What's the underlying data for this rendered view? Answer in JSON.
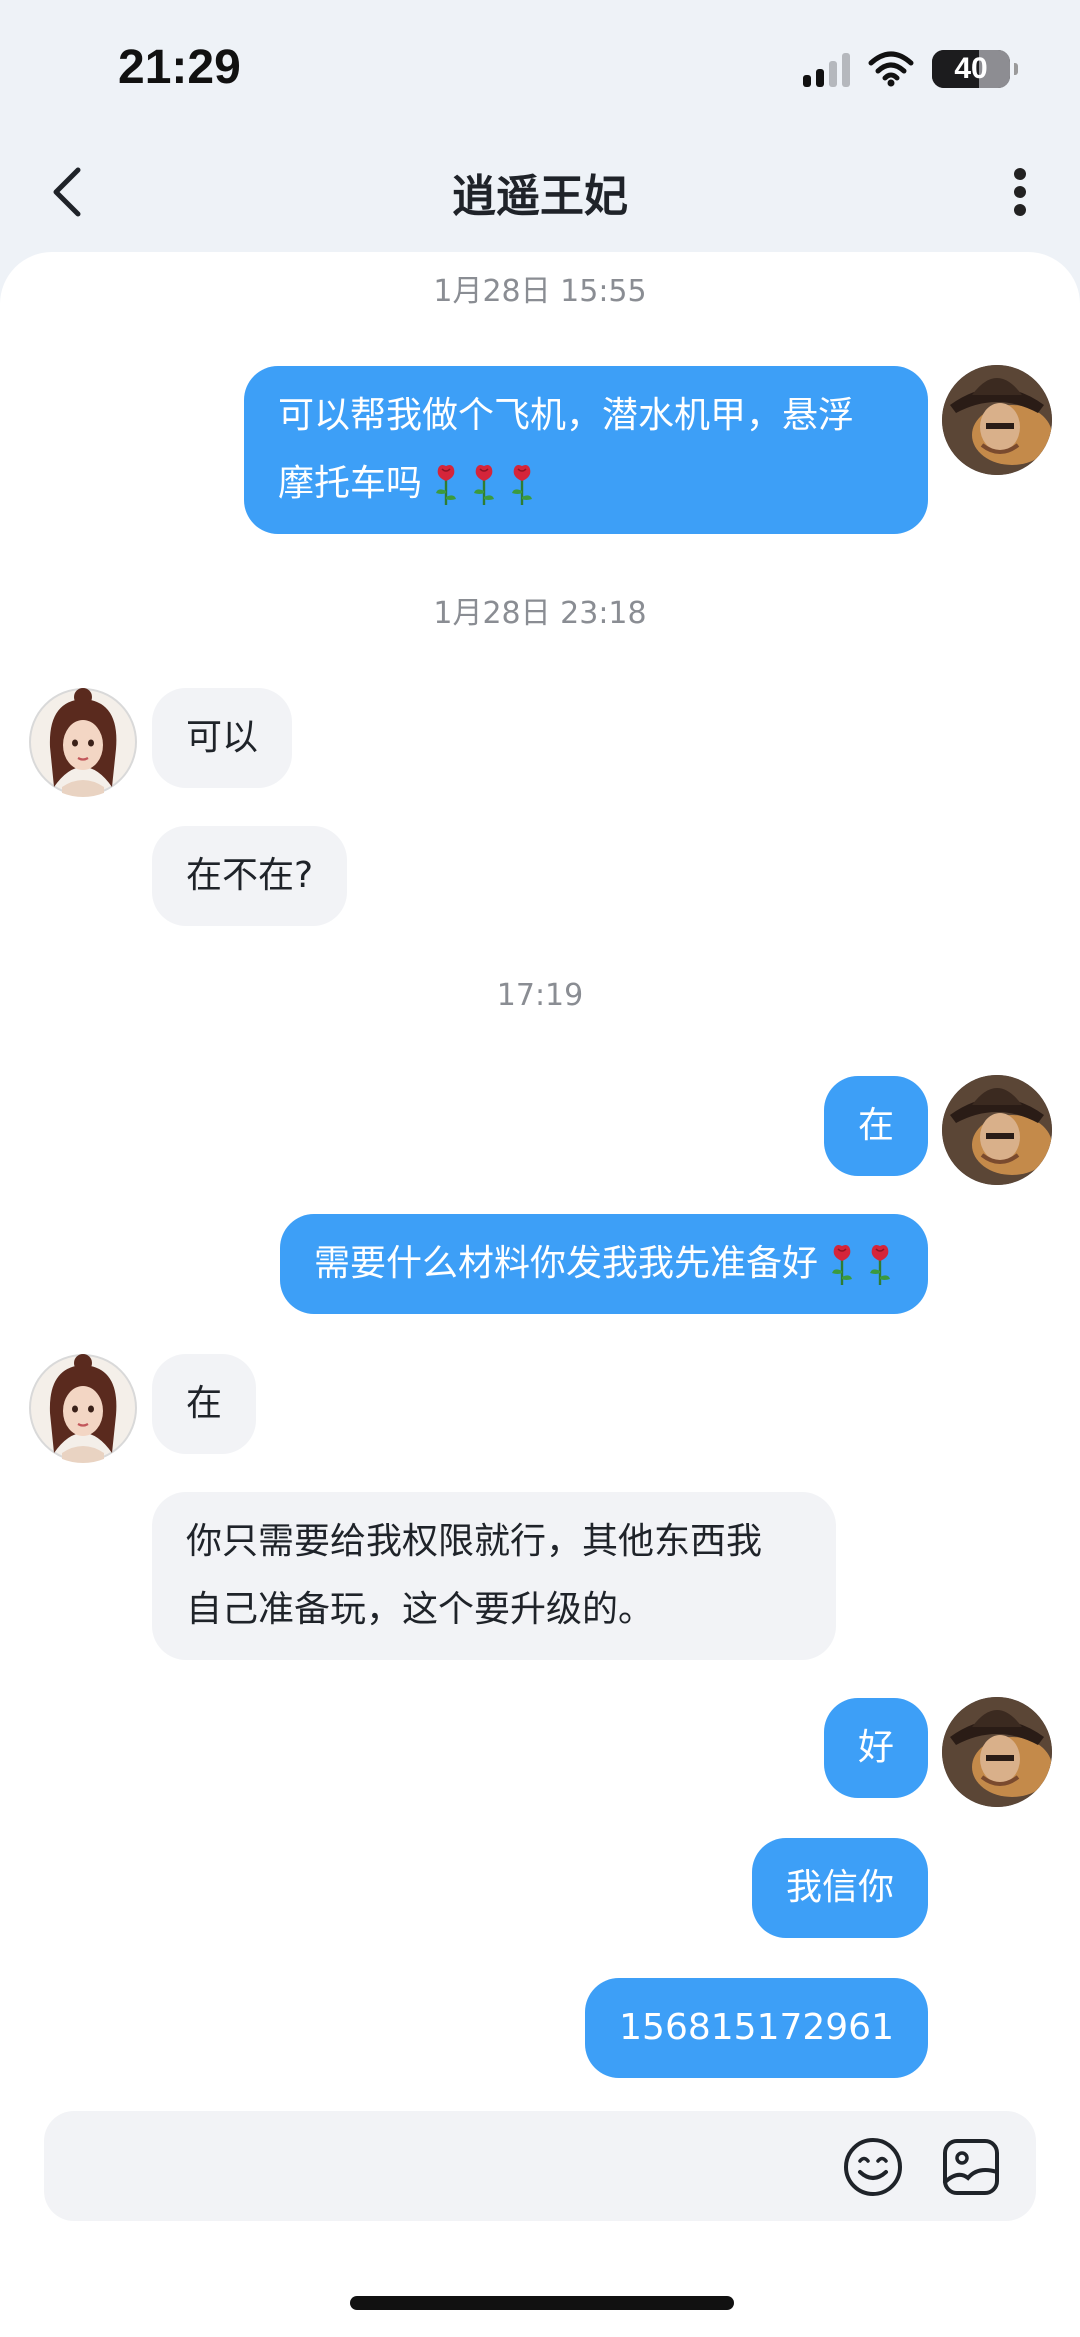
{
  "status_bar": {
    "time": "21:29",
    "battery": "40"
  },
  "header": {
    "title": "逍遥王妃"
  },
  "messages": {
    "ts1": "1月28日 15:55",
    "m1_line1": "可以帮我做个飞机，潜水机甲，悬浮",
    "m1_line2": "摩托车吗",
    "ts2": "1月28日 23:18",
    "m2": "可以",
    "m3": "在不在?",
    "ts3": "17:19",
    "m4": "在",
    "m5": "需要什么材料你发我我先准备好",
    "m6": "在",
    "m7_line1": "你只需要给我权限就行，其他东西我",
    "m7_line2": "自己准备玩，这个要升级的。",
    "m8": "好",
    "m9": "我信你",
    "m10": "156815172961"
  },
  "input": {
    "placeholder": ""
  },
  "icons": {
    "back": "chevron-left-icon",
    "more": "vertical-dots-icon",
    "emoji": "smiley-icon",
    "sticker": "image-sticker-icon",
    "rose": "rose-emoji-icon"
  },
  "colors": {
    "my_bubble": "#3d9ff7",
    "their_bubble": "#f2f3f6",
    "header_bg": "#eef2f7"
  }
}
